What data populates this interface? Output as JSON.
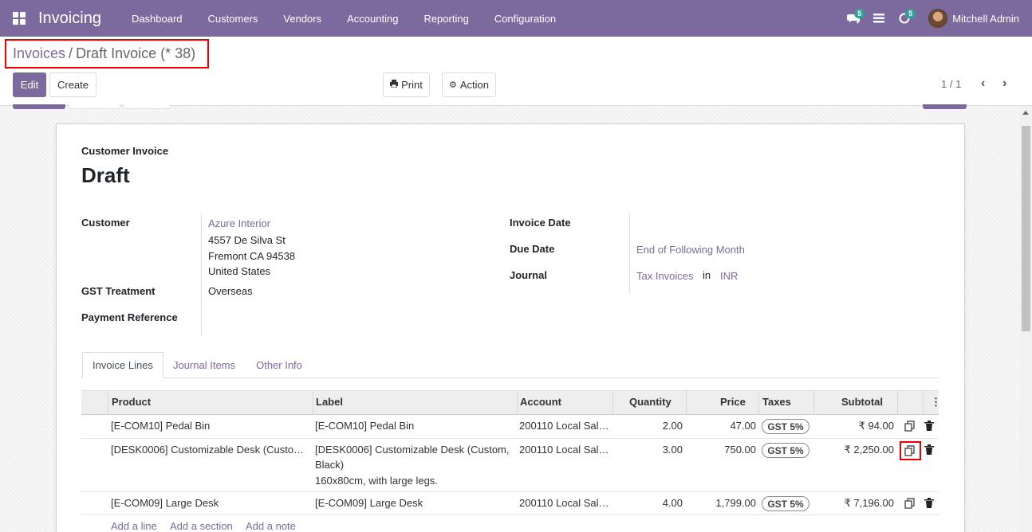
{
  "navbar": {
    "app_title": "Invoicing",
    "menu": [
      "Dashboard",
      "Customers",
      "Vendors",
      "Accounting",
      "Reporting",
      "Configuration"
    ],
    "messages_count": "5",
    "activities_count": "5",
    "user_name": "Mitchell Admin",
    "color": "#7C6A9E"
  },
  "breadcrumb": {
    "parent": "Invoices",
    "separator": "/",
    "current": "Draft Invoice (* 38)"
  },
  "buttons": {
    "edit": "Edit",
    "create": "Create",
    "print": "Print",
    "action": "Action"
  },
  "pager": {
    "text": "1 / 1"
  },
  "invoice": {
    "type": "Customer Invoice",
    "state": "Draft",
    "customer_label": "Customer",
    "customer_name": "Azure Interior",
    "address_line1": "4557 De Silva St",
    "address_line2": "Fremont CA 94538",
    "address_line3": "United States",
    "gst_label": "GST Treatment",
    "gst_value": "Overseas",
    "payment_ref_label": "Payment Reference",
    "invoice_date_label": "Invoice Date",
    "due_date_label": "Due Date",
    "due_date_value": "End of Following Month",
    "journal_label": "Journal",
    "journal_value": "Tax Invoices",
    "journal_in": "in",
    "currency": "INR"
  },
  "tabs": [
    "Invoice Lines",
    "Journal Items",
    "Other Info"
  ],
  "table": {
    "headers": [
      "Product",
      "Label",
      "Account",
      "Quantity",
      "Price",
      "Taxes",
      "Subtotal"
    ],
    "rows": [
      {
        "product": "[E-COM10] Pedal Bin",
        "label": "[E-COM10] Pedal Bin",
        "label2": "",
        "label3": "",
        "account": "200110 Local Sal…",
        "quantity": "2.00",
        "price": "47.00",
        "tax": "GST 5%",
        "subtotal": "₹ 94.00"
      },
      {
        "product": "[DESK0006] Customizable Desk (Custo…",
        "label": "[DESK0006] Customizable Desk (Custom,",
        "label2": "Black)",
        "label3": "160x80cm, with large legs.",
        "account": "200110 Local Sal…",
        "quantity": "3.00",
        "price": "750.00",
        "tax": "GST 5%",
        "subtotal": "₹ 2,250.00"
      },
      {
        "product": "[E-COM09] Large Desk",
        "label": "[E-COM09] Large Desk",
        "label2": "",
        "label3": "",
        "account": "200110 Local Sal…",
        "quantity": "4.00",
        "price": "1,799.00",
        "tax": "GST 5%",
        "subtotal": "₹ 7,196.00"
      }
    ],
    "add_line": "Add a line",
    "add_section": "Add a section",
    "add_note": "Add a note"
  }
}
